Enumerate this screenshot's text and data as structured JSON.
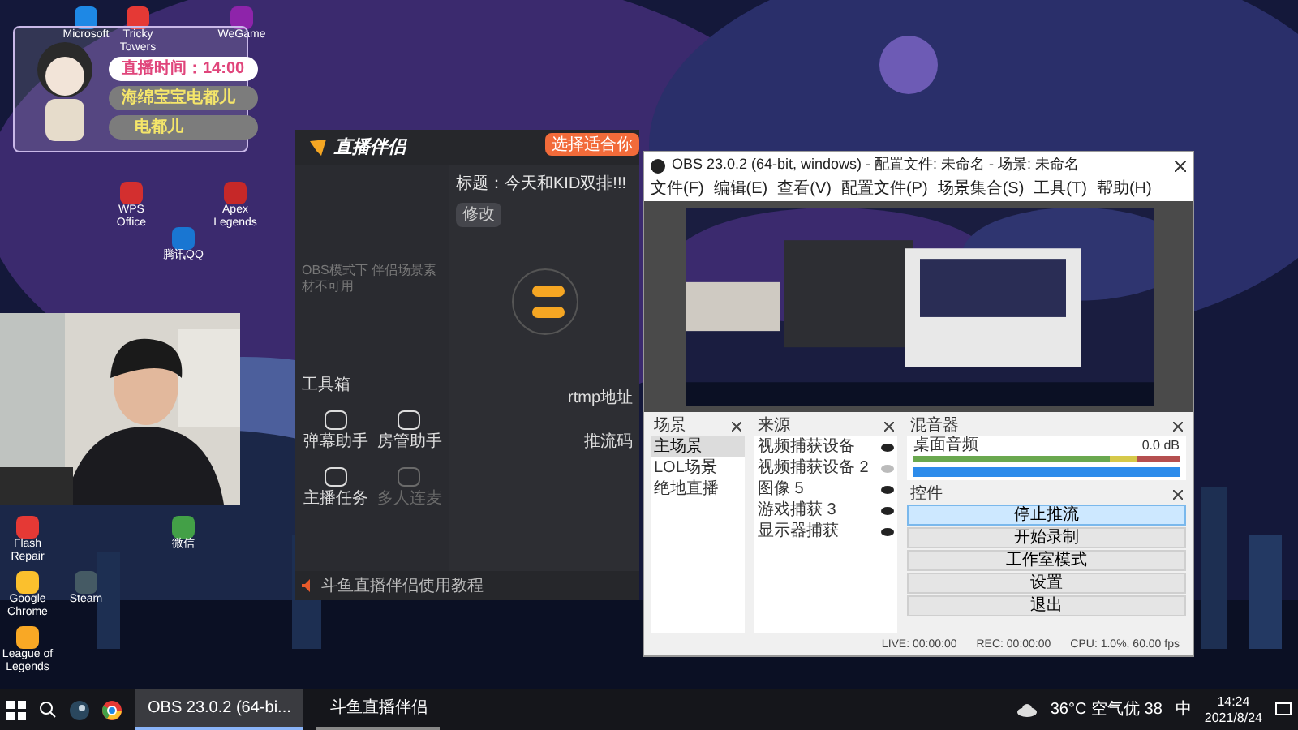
{
  "desktop_icons": [
    {
      "label": "Microsoft"
    },
    {
      "label": "Tricky Towers"
    },
    {
      "label": "WeGame"
    },
    {
      "label": "WPS Office"
    },
    {
      "label": "Apex Legends"
    },
    {
      "label": "腾讯QQ"
    },
    {
      "label": "Flash Repair"
    },
    {
      "label": "微信"
    },
    {
      "label": "Google Chrome"
    },
    {
      "label": "Steam"
    },
    {
      "label": "League of Legends"
    }
  ],
  "widget": {
    "time": "直播时间：14:00",
    "name": "海绵宝宝电都儿",
    "short": "电都儿"
  },
  "stream_app": {
    "logo": "直播伴侣",
    "empty_note": "OBS模式下 伴侣场景素材不可用",
    "toolbox": "工具箱",
    "tools": [
      {
        "label": "弹幕助手",
        "disabled": false
      },
      {
        "label": "房管助手",
        "disabled": false
      },
      {
        "label": "主播任务",
        "disabled": false
      },
      {
        "label": "多人连麦",
        "disabled": true
      }
    ],
    "title_label": "标题：今天和KID双排!!!",
    "edit_button": "修改",
    "tip": "选择适合你",
    "rtmp_label": "rtmp地址",
    "key_label": "推流码",
    "tutorial": "斗鱼直播伴侣使用教程"
  },
  "obs": {
    "title": "OBS 23.0.2 (64-bit, windows) - 配置文件: 未命名 - 场景: 未命名",
    "menu": [
      "文件(F)",
      "编辑(E)",
      "查看(V)",
      "配置文件(P)",
      "场景集合(S)",
      "工具(T)",
      "帮助(H)"
    ],
    "scenes_title": "场景",
    "scenes": [
      {
        "name": "主场景",
        "selected": true
      },
      {
        "name": "LOL场景",
        "selected": false
      },
      {
        "name": "绝地直播",
        "selected": false
      }
    ],
    "sources_title": "来源",
    "sources": [
      {
        "name": "视频捕获设备",
        "visible": true
      },
      {
        "name": "视频捕获设备 2",
        "visible": false
      },
      {
        "name": "图像 5",
        "visible": true
      },
      {
        "name": "游戏捕获 3",
        "visible": true
      },
      {
        "name": "显示器捕获",
        "visible": true
      }
    ],
    "mixer_title": "混音器",
    "mixer": {
      "name": "桌面音频",
      "reading": "0.0 dB",
      "level": 1
    },
    "controls_title": "控件",
    "controls": [
      {
        "label": "停止推流",
        "active": true
      },
      {
        "label": "开始录制",
        "active": false
      },
      {
        "label": "工作室模式",
        "active": false
      },
      {
        "label": "设置",
        "active": false
      },
      {
        "label": "退出",
        "active": false
      }
    ],
    "status": [
      "LIVE: 00:00:00",
      "REC: 00:00:00",
      "CPU: 1.0%, 60.00 fps"
    ]
  },
  "taskbar": {
    "apps": [
      {
        "label": "OBS 23.0.2 (64-bi...",
        "selected": true
      },
      {
        "label": "斗鱼直播伴侣",
        "selected": false
      }
    ],
    "weather": "36°C 空气优 38",
    "ime": "中",
    "time": "14:24",
    "date": "2021/8/24"
  }
}
